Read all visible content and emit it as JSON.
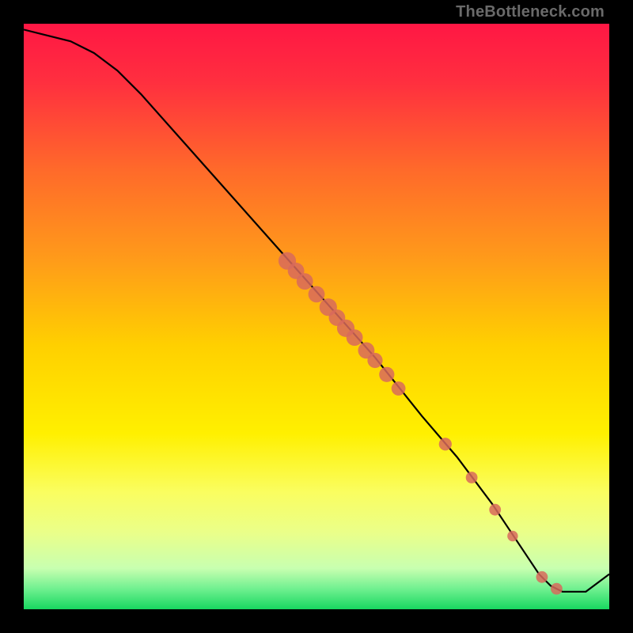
{
  "watermark": "TheBottleneck.com",
  "gradient_stops": [
    {
      "pos": 0.0,
      "color": "#ff1744"
    },
    {
      "pos": 0.1,
      "color": "#ff2f3f"
    },
    {
      "pos": 0.25,
      "color": "#ff6a2a"
    },
    {
      "pos": 0.4,
      "color": "#ff9a1a"
    },
    {
      "pos": 0.55,
      "color": "#ffd000"
    },
    {
      "pos": 0.7,
      "color": "#fff000"
    },
    {
      "pos": 0.8,
      "color": "#fafe60"
    },
    {
      "pos": 0.87,
      "color": "#eaff8a"
    },
    {
      "pos": 0.93,
      "color": "#c8ffb0"
    },
    {
      "pos": 0.965,
      "color": "#70f090"
    },
    {
      "pos": 1.0,
      "color": "#18d860"
    }
  ],
  "chart_data": {
    "type": "line",
    "title": "",
    "xlabel": "",
    "ylabel": "",
    "xlim": [
      0,
      100
    ],
    "ylim": [
      0,
      100
    ],
    "series": [
      {
        "name": "curve",
        "x": [
          0,
          4,
          8,
          12,
          16,
          20,
          28,
          36,
          44,
          52,
          60,
          68,
          74,
          80,
          84,
          88,
          90,
          92,
          96,
          100
        ],
        "y": [
          99,
          98,
          97,
          95,
          92,
          88,
          79,
          70,
          61,
          52,
          43,
          33,
          26,
          18,
          12,
          6,
          4,
          3,
          3,
          6
        ]
      }
    ],
    "markers": {
      "name": "points",
      "color": "#d86a5c",
      "items": [
        {
          "x": 45.0,
          "y": 59.5,
          "r": 1.5
        },
        {
          "x": 46.5,
          "y": 57.8,
          "r": 1.4
        },
        {
          "x": 48.0,
          "y": 56.0,
          "r": 1.4
        },
        {
          "x": 50.0,
          "y": 53.8,
          "r": 1.4
        },
        {
          "x": 52.0,
          "y": 51.6,
          "r": 1.5
        },
        {
          "x": 53.5,
          "y": 49.8,
          "r": 1.4
        },
        {
          "x": 55.0,
          "y": 48.0,
          "r": 1.5
        },
        {
          "x": 56.5,
          "y": 46.4,
          "r": 1.4
        },
        {
          "x": 58.5,
          "y": 44.2,
          "r": 1.4
        },
        {
          "x": 60.0,
          "y": 42.5,
          "r": 1.3
        },
        {
          "x": 62.0,
          "y": 40.1,
          "r": 1.3
        },
        {
          "x": 64.0,
          "y": 37.7,
          "r": 1.2
        },
        {
          "x": 72.0,
          "y": 28.2,
          "r": 1.1
        },
        {
          "x": 76.5,
          "y": 22.5,
          "r": 1.0
        },
        {
          "x": 80.5,
          "y": 17.0,
          "r": 1.0
        },
        {
          "x": 83.5,
          "y": 12.5,
          "r": 0.9
        },
        {
          "x": 88.5,
          "y": 5.5,
          "r": 1.0
        },
        {
          "x": 91.0,
          "y": 3.5,
          "r": 1.0
        }
      ]
    }
  }
}
